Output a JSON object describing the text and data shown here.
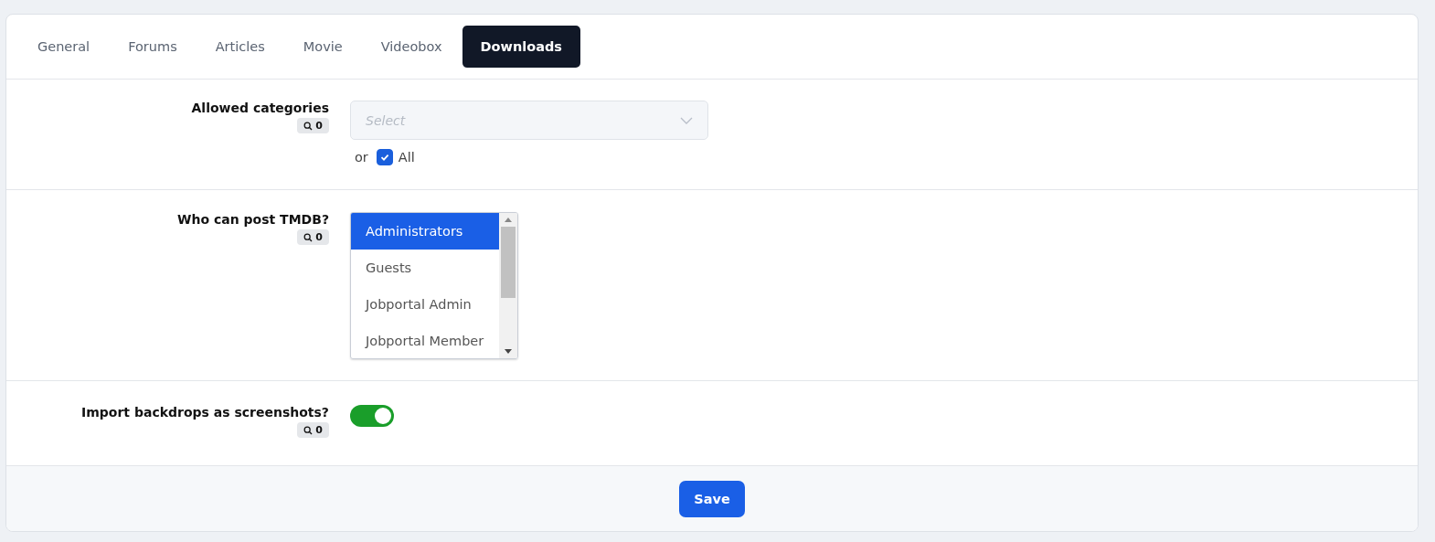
{
  "tabs": [
    {
      "label": "General",
      "selected": false
    },
    {
      "label": "Forums",
      "selected": false
    },
    {
      "label": "Articles",
      "selected": false
    },
    {
      "label": "Movie",
      "selected": false
    },
    {
      "label": "Videobox",
      "selected": false
    },
    {
      "label": "Downloads",
      "selected": true
    }
  ],
  "fields": [
    {
      "kind": "select",
      "label": "Allowed categories",
      "badge": "0",
      "placeholder": "Select",
      "or_text": "or",
      "all_label": "All",
      "all_checked": true
    },
    {
      "kind": "listbox",
      "label": "Who can post TMDB?",
      "badge": "0",
      "options": [
        {
          "label": "Administrators",
          "selected": true
        },
        {
          "label": "Guests",
          "selected": false
        },
        {
          "label": "Jobportal Admin",
          "selected": false
        },
        {
          "label": "Jobportal Member",
          "selected": false
        }
      ]
    },
    {
      "kind": "toggle",
      "label": "Import backdrops as screenshots?",
      "badge": "0",
      "on": true
    }
  ],
  "save_button": "Save"
}
